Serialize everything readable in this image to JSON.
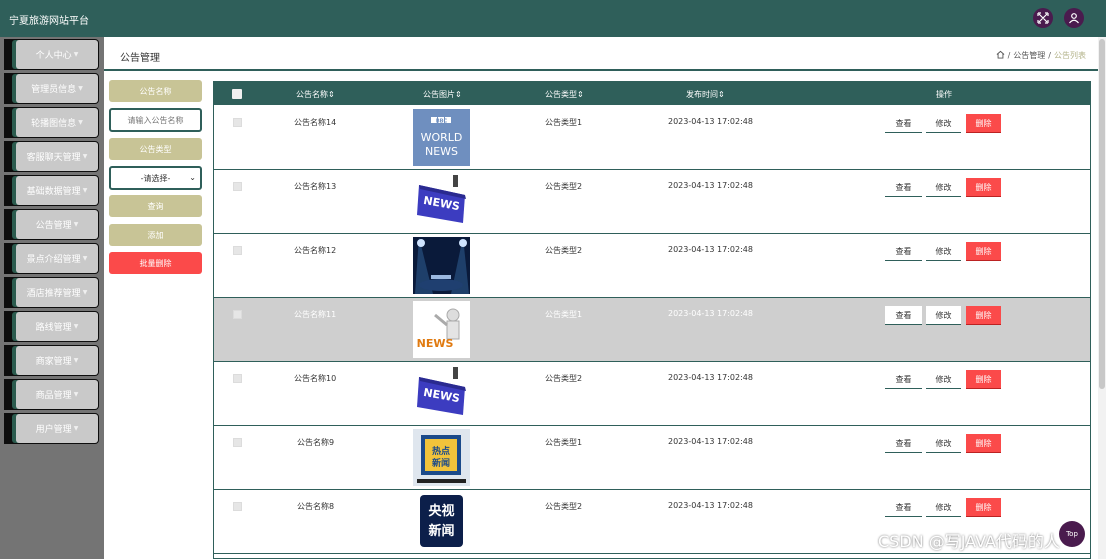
{
  "header": {
    "title": "宁夏旅游网站平台",
    "icons": [
      "fullscreen-icon",
      "user-icon"
    ]
  },
  "sidebar": {
    "items": [
      {
        "label": "个人中心"
      },
      {
        "label": "管理员信息"
      },
      {
        "label": "轮播图信息"
      },
      {
        "label": "客服聊天管理"
      },
      {
        "label": "基础数据管理"
      },
      {
        "label": "公告管理"
      },
      {
        "label": "景点介绍管理"
      },
      {
        "label": "酒店推荐管理"
      },
      {
        "label": "路线管理"
      },
      {
        "label": "商家管理"
      },
      {
        "label": "商品管理"
      },
      {
        "label": "用户管理"
      }
    ]
  },
  "breadcrumb": {
    "title": "公告管理",
    "path": [
      "公告管理",
      "公告列表"
    ],
    "sep": "/"
  },
  "filters": {
    "name_label": "公告名称",
    "name_placeholder": "请输入公告名称",
    "type_label": "公告类型",
    "type_selected": "-请选择-",
    "search_label": "查询",
    "add_label": "添加",
    "batch_delete_label": "批量删除"
  },
  "table": {
    "headers": {
      "name": "公告名称",
      "image": "公告图片",
      "type": "公告类型",
      "time": "发布时间",
      "ops": "操作"
    },
    "sort_glyph": "⇕",
    "actions": {
      "view": "查看",
      "edit": "修改",
      "delete": "删除"
    },
    "rows": [
      {
        "name": "公告名称14",
        "type": "公告类型1",
        "time": "2023-04-13 17:02:48",
        "image": "bbc-world-news"
      },
      {
        "name": "公告名称13",
        "type": "公告类型2",
        "time": "2023-04-13 17:02:48",
        "image": "news-3d"
      },
      {
        "name": "公告名称12",
        "type": "公告类型2",
        "time": "2023-04-13 17:02:48",
        "image": "stage-spotlight"
      },
      {
        "name": "公告名称11",
        "type": "公告类型1",
        "time": "2023-04-13 17:02:48",
        "image": "news-figure",
        "highlighted": true
      },
      {
        "name": "公告名称10",
        "type": "公告类型2",
        "time": "2023-04-13 17:02:48",
        "image": "news-3d"
      },
      {
        "name": "公告名称9",
        "type": "公告类型1",
        "time": "2023-04-13 17:02:48",
        "image": "hot-news"
      },
      {
        "name": "公告名称8",
        "type": "公告类型2",
        "time": "2023-04-13 17:02:48",
        "image": "cctv-news"
      }
    ]
  },
  "image_text": {
    "bbc": "BBC",
    "world": "WORLD",
    "news": "NEWS",
    "cctv_a": "央视",
    "cctv_b": "新闻",
    "hot_a": "热点",
    "hot_b": "新闻"
  },
  "watermark": "CSDN @写JAVA代码的人",
  "top_button": "Top",
  "colors": {
    "primary": "#2f5f5a",
    "danger": "#fb4a4a",
    "filter_btn": "#c8c496",
    "sidebar_bg": "#747474"
  }
}
